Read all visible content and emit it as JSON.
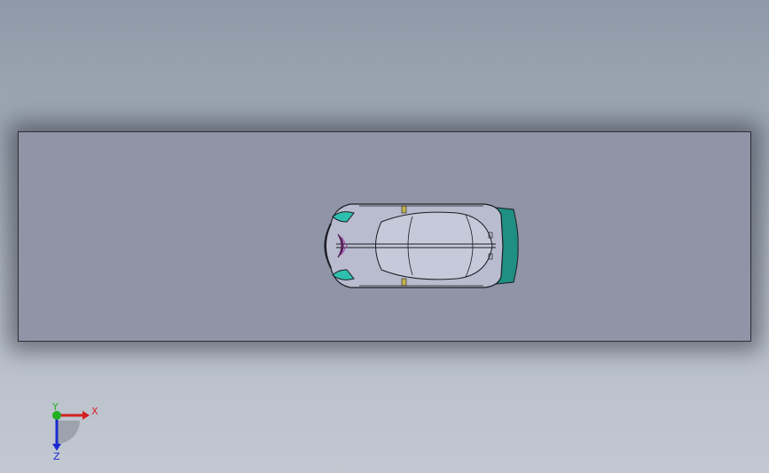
{
  "app": {
    "view": "top-view-3d-model"
  },
  "triad": {
    "x_label": "X",
    "y_label": "Y",
    "z_label": "Z"
  },
  "colors": {
    "background_top": "#8e9aa8",
    "background_bottom": "#c2c8d1",
    "ground_plane": "#8f94a7",
    "car_body": "#b9bccf",
    "accent_teal": "#2fbfae",
    "rear_wing": "#1e8f82",
    "axis_x": "#d22020",
    "axis_y": "#22b022",
    "axis_z": "#1a2ad0"
  }
}
